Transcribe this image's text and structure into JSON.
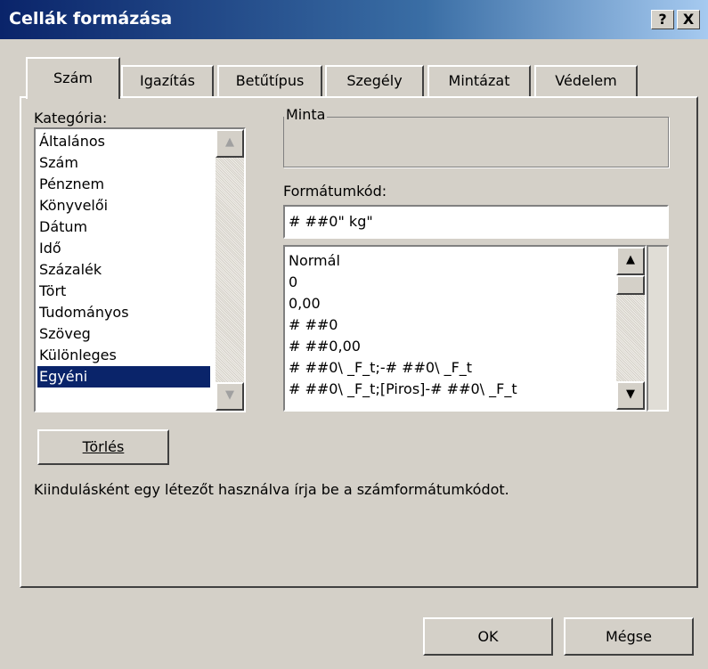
{
  "window": {
    "title": "Cellák formázása",
    "help_button": "?",
    "close_button": "X"
  },
  "tabs": [
    {
      "label": "Szám",
      "active": true
    },
    {
      "label": "Igazítás"
    },
    {
      "label": "Betűtípus"
    },
    {
      "label": "Szegély"
    },
    {
      "label": "Mintázat"
    },
    {
      "label": "Védelem"
    }
  ],
  "category": {
    "label": "Kategória:",
    "items": [
      "Általános",
      "Szám",
      "Pénznem",
      "Könyvelői",
      "Dátum",
      "Idő",
      "Százalék",
      "Tört",
      "Tudományos",
      "Szöveg",
      "Különleges",
      "Egyéni"
    ],
    "selected": "Egyéni"
  },
  "sample": {
    "label": "Minta"
  },
  "format_code": {
    "label": "Formátumkód:",
    "value": "# ##0\" kg\"",
    "list": [
      "Normál",
      "0",
      "0,00",
      "# ##0",
      "# ##0,00",
      "# ##0\\ _F_t;-# ##0\\ _F_t",
      "# ##0\\ _F_t;[Piros]-# ##0\\ _F_t"
    ]
  },
  "delete_button": "Törlés",
  "hint": "Kiindulásként egy létezőt használva írja be a számformátumkódot.",
  "ok_button": "OK",
  "cancel_button": "Mégse"
}
